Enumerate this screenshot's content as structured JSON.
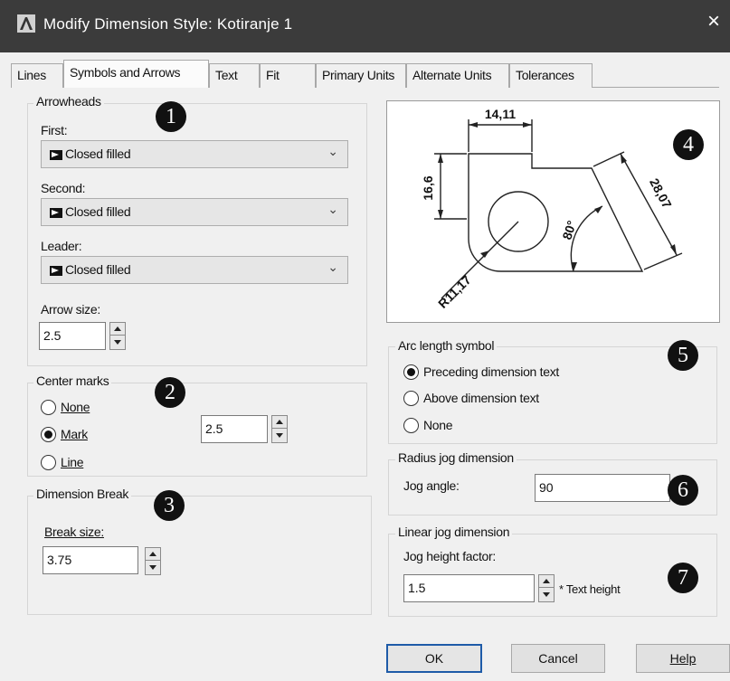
{
  "window": {
    "title": "Modify Dimension Style: Kotiranje 1",
    "close": "×"
  },
  "tabs": [
    {
      "label": "Lines"
    },
    {
      "label": "Symbols and Arrows"
    },
    {
      "label": "Text"
    },
    {
      "label": "Fit"
    },
    {
      "label": "Primary Units"
    },
    {
      "label": "Alternate Units"
    },
    {
      "label": "Tolerances"
    }
  ],
  "arrowheads": {
    "title": "Arrowheads",
    "first_label": "First:",
    "first_value": "Closed filled",
    "second_label": "Second:",
    "second_value": "Closed filled",
    "leader_label": "Leader:",
    "leader_value": "Closed filled",
    "arrow_size_label": "Arrow size:",
    "arrow_size_value": "2.5"
  },
  "center_marks": {
    "title": "Center marks",
    "none": "None",
    "mark": "Mark",
    "line": "Line",
    "size_value": "2.5"
  },
  "dimension_break": {
    "title": "Dimension Break",
    "break_size_label": "Break size:",
    "break_size_value": "3.75"
  },
  "preview": {
    "dim_top": "14,11",
    "dim_left": "16,6",
    "dim_diag": "28,07",
    "dim_angle": "80°",
    "dim_radius": "R11,17"
  },
  "arc_length": {
    "title": "Arc length symbol",
    "preceding": "Preceding dimension text",
    "above": "Above dimension text",
    "none": "None"
  },
  "radius_jog": {
    "title": "Radius jog dimension",
    "jog_angle_label": "Jog angle:",
    "jog_angle_value": "90"
  },
  "linear_jog": {
    "title": "Linear jog dimension",
    "factor_label": "Jog height factor:",
    "factor_value": "1.5",
    "text_height": "* Text height"
  },
  "badges": [
    "1",
    "2",
    "3",
    "4",
    "5",
    "6",
    "7"
  ],
  "buttons": {
    "ok": "OK",
    "cancel": "Cancel",
    "help": "Help"
  }
}
